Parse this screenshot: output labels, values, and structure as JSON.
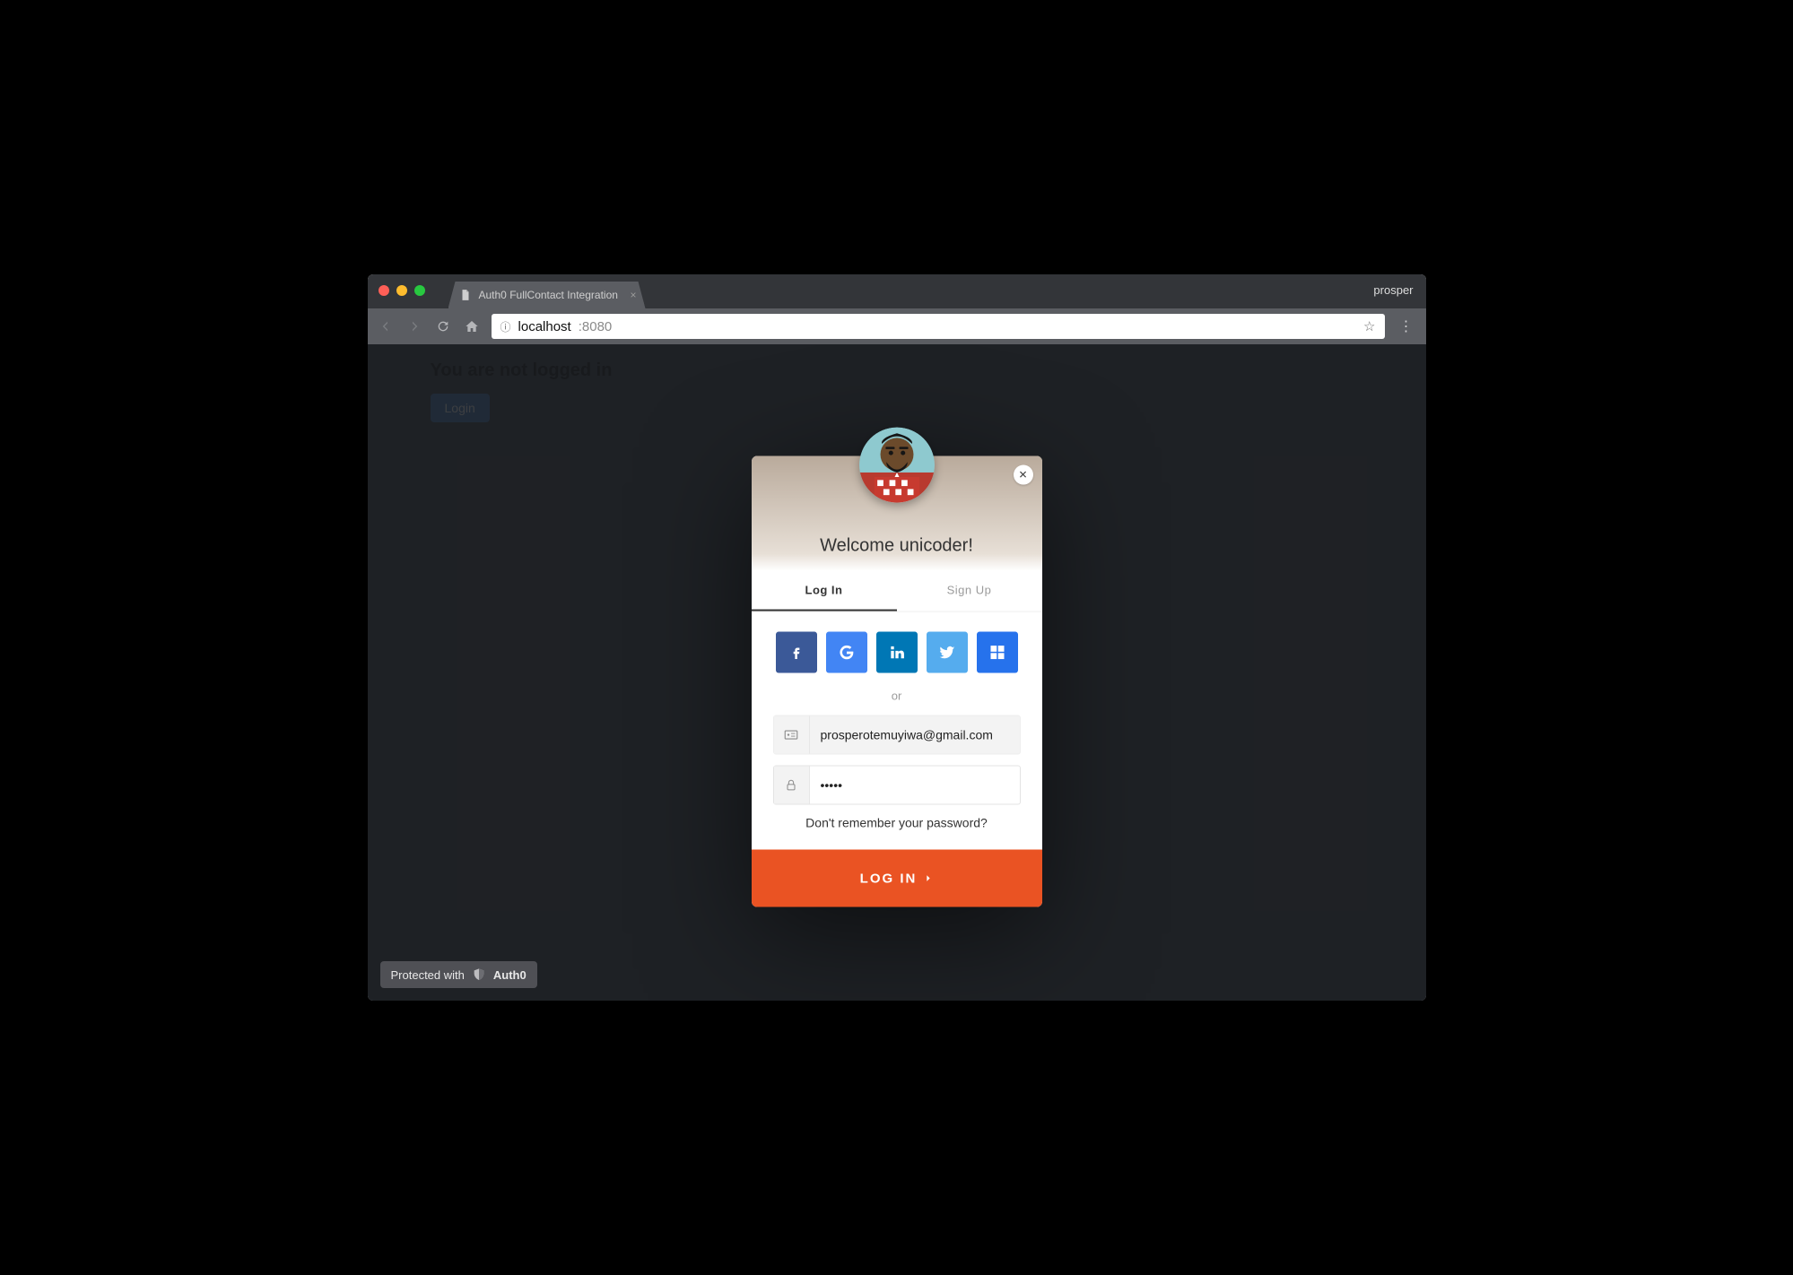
{
  "browser": {
    "tab_title": "Auth0 FullContact Integration",
    "profile_label": "prosper",
    "url_host": "localhost",
    "url_port": ":8080"
  },
  "page": {
    "not_logged_in": "You are not logged in",
    "login_button": "Login"
  },
  "modal": {
    "welcome": "Welcome unicoder!",
    "tabs": {
      "login": "Log In",
      "signup": "Sign Up"
    },
    "divider": "or",
    "email_value": "prosperotemuyiwa@gmail.com",
    "password_value": "•••••",
    "forgot": "Don't remember your password?",
    "submit": "LOG IN"
  },
  "social": {
    "facebook": "facebook-icon",
    "google": "google-icon",
    "linkedin": "linkedin-icon",
    "twitter": "twitter-icon",
    "microsoft": "microsoft-icon"
  },
  "badge": {
    "text": "Protected with",
    "brand": "Auth0"
  }
}
